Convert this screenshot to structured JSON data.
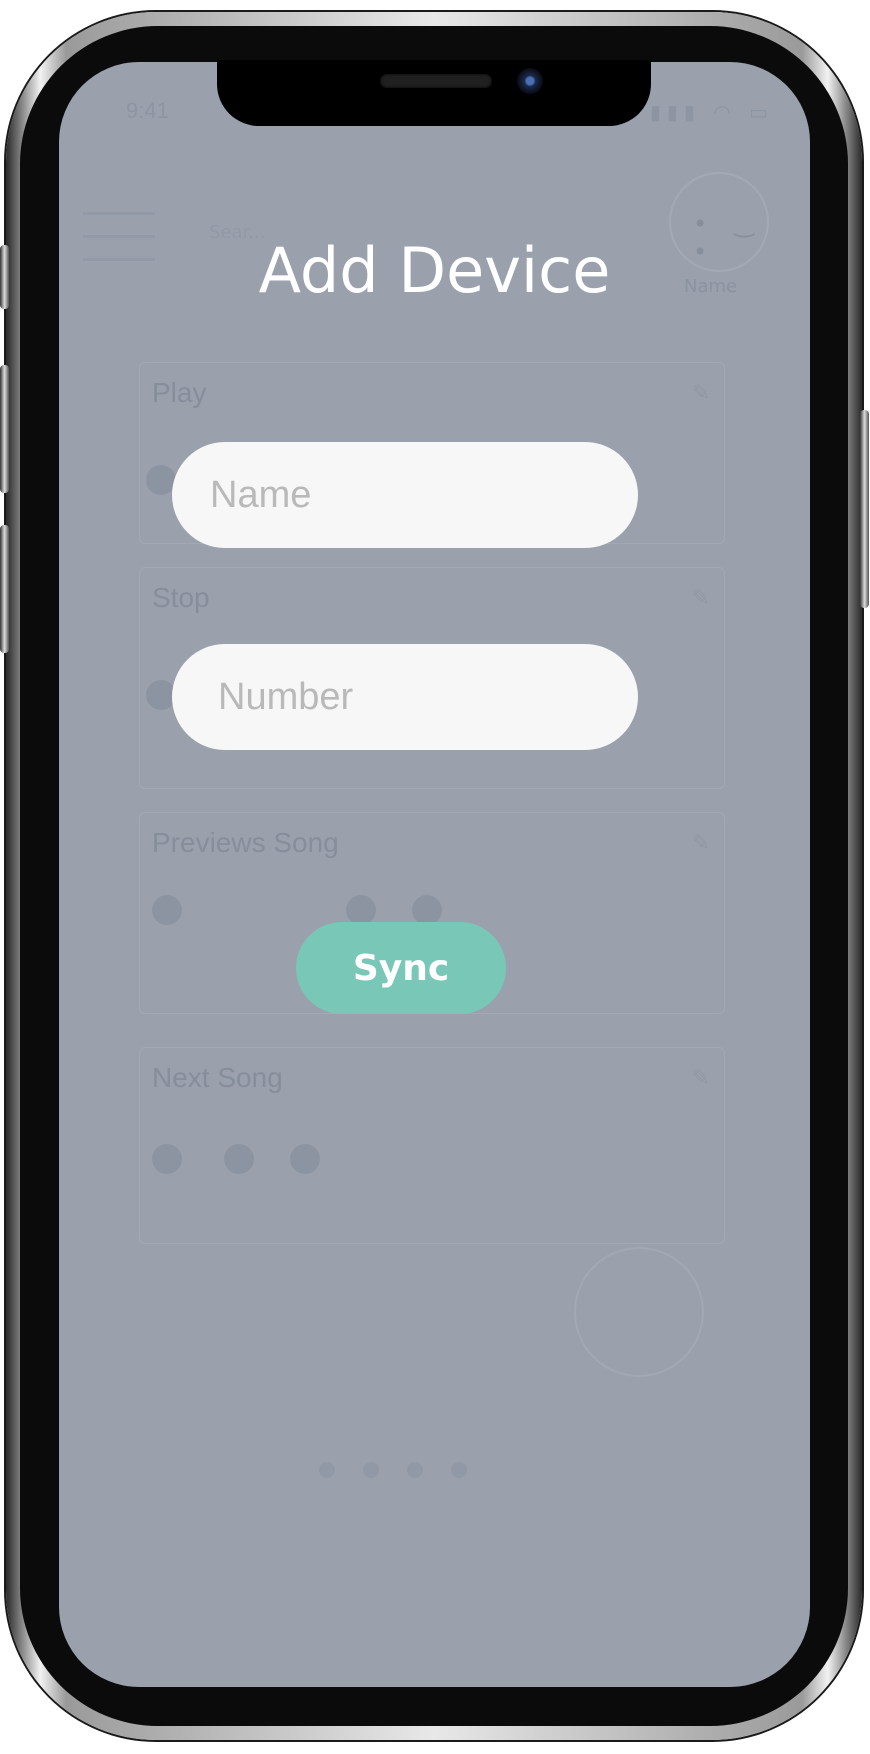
{
  "status_bar": {
    "time": "9:41",
    "icons": "▮▮▮ ◠ ▭"
  },
  "background_app": {
    "search_text": "Sear...",
    "profile_label": "Name",
    "cards": [
      {
        "title": "Play"
      },
      {
        "title": "Stop"
      },
      {
        "title": "Previews Song"
      },
      {
        "title": "Next Song"
      }
    ]
  },
  "modal": {
    "title": "Add Device",
    "name_placeholder": "Name",
    "number_placeholder": "Number",
    "sync_label": "Sync"
  },
  "colors": {
    "overlay": "#9aa1ad",
    "accent": "#79c7b7",
    "field": "#f7f7f7"
  }
}
